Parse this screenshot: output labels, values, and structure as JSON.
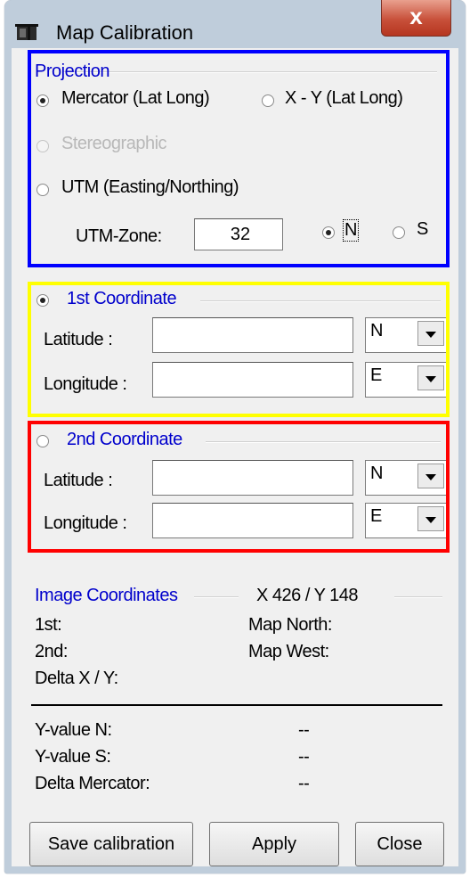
{
  "window": {
    "title": "Map Calibration",
    "close_label": "x"
  },
  "projection": {
    "legend": "Projection",
    "mercator": "Mercator (Lat  Long)",
    "xy": "X - Y (Lat  Long)",
    "stereographic": "Stereographic",
    "utm": "UTM (Easting/Northing)",
    "utm_zone_label": "UTM-Zone:",
    "utm_zone_value": "32",
    "n_label": "N",
    "s_label": "S",
    "selected": "mercator",
    "hemisphere": "N"
  },
  "coord1": {
    "legend": "1st Coordinate",
    "selected": true,
    "lat_label": "Latitude :",
    "lat_value": "",
    "lat_dir": "N",
    "lon_label": "Longitude :",
    "lon_value": "",
    "lon_dir": "E"
  },
  "coord2": {
    "legend": "2nd Coordinate",
    "selected": false,
    "lat_label": "Latitude :",
    "lat_value": "",
    "lat_dir": "N",
    "lon_label": "Longitude :",
    "lon_value": "",
    "lon_dir": "E"
  },
  "image_coords": {
    "legend": "Image Coordinates",
    "cursor_xy": "X 426 / Y 148",
    "first_label": "1st:",
    "second_label": "2nd:",
    "map_north_label": "Map North:",
    "map_west_label": "Map West:",
    "delta_label": "Delta X / Y:",
    "y_n_label": "Y-value N:",
    "y_n_value": "--",
    "y_s_label": "Y-value S:",
    "y_s_value": "--",
    "delta_mercator_label": "Delta Mercator:",
    "delta_mercator_value": "--"
  },
  "buttons": {
    "save": "Save calibration",
    "apply": "Apply",
    "close": "Close"
  },
  "highlight_colors": {
    "projection": "#0000ff",
    "coord1": "#ffff00",
    "coord2": "#ff0000"
  }
}
